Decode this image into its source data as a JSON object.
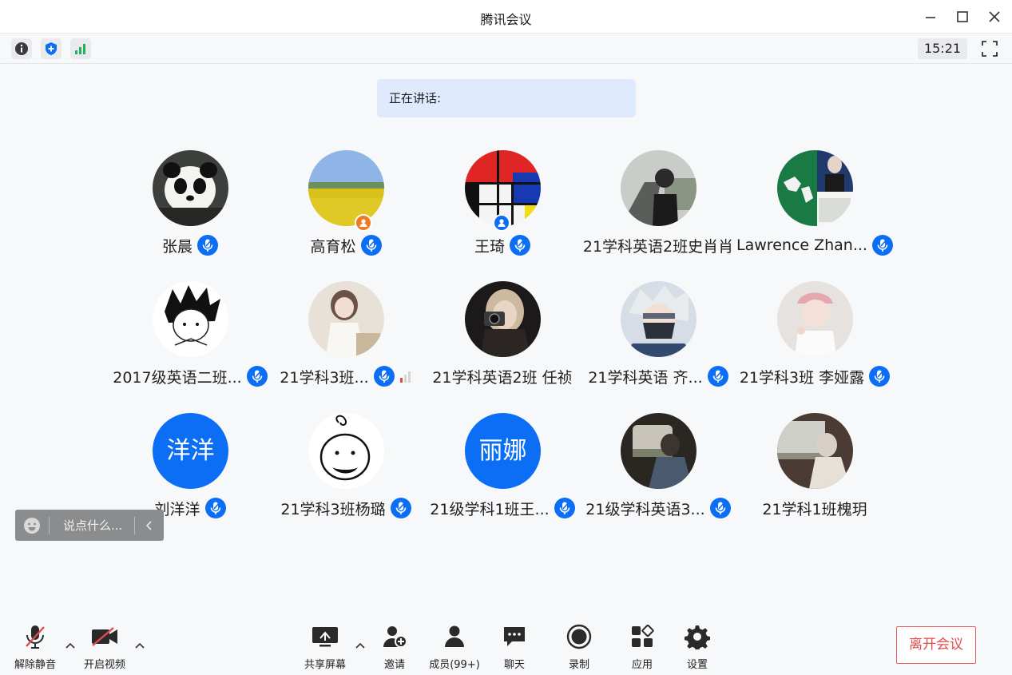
{
  "window": {
    "title": "腾讯会议"
  },
  "topbar": {
    "time": "15:21"
  },
  "speaking": {
    "label": "正在讲话:"
  },
  "participants": [
    {
      "name": "张晨",
      "avatar": "panda-photo",
      "audio": "on"
    },
    {
      "name": "高育松",
      "avatar": "field-photo",
      "audio": "on",
      "host": true
    },
    {
      "name": "王琦",
      "avatar": "mondrian-photo",
      "audio": "on",
      "cohost": true
    },
    {
      "name": "21学科英语2班史肖肖",
      "avatar": "road-photo",
      "audio": "none"
    },
    {
      "name": "Lawrence Zhan...",
      "avatar": "map-photo",
      "audio": "on"
    },
    {
      "name": "2017级英语二班...",
      "avatar": "sketch-photo",
      "audio": "on"
    },
    {
      "name": "21学科3班...",
      "avatar": "girl-photo",
      "audio": "on",
      "signal": true
    },
    {
      "name": "21学科英语2班 任祯",
      "avatar": "camera-photo",
      "audio": "none"
    },
    {
      "name": "21学科英语 齐...",
      "avatar": "anime-photo",
      "audio": "on"
    },
    {
      "name": "21学科3班 李娅露",
      "avatar": "kid-photo",
      "audio": "on"
    },
    {
      "name": "刘洋洋",
      "avatar_text": "洋洋",
      "audio": "on"
    },
    {
      "name": "21学科3班杨璐",
      "avatar": "doodle-photo",
      "audio": "on"
    },
    {
      "name": "21级学科1班王...",
      "avatar_text": "丽娜",
      "audio": "on"
    },
    {
      "name": "21级学科英语3...",
      "avatar": "car-window-photo",
      "audio": "on"
    },
    {
      "name": "21学科1班槐玥",
      "avatar": "train-photo",
      "audio": "none"
    }
  ],
  "chat": {
    "placeholder": "说点什么..."
  },
  "bottombar": {
    "unmute": "解除静音",
    "video": "开启视频",
    "share": "共享屏幕",
    "invite": "邀请",
    "members": "成员(99+)",
    "chat": "聊天",
    "record": "录制",
    "apps": "应用",
    "settings": "设置",
    "leave": "离开会议"
  },
  "colors": {
    "accent": "#0b6ef5",
    "leave": "#e34b4b",
    "speaking_bg": "#dfeafe",
    "signal_green": "#1fb35a"
  }
}
